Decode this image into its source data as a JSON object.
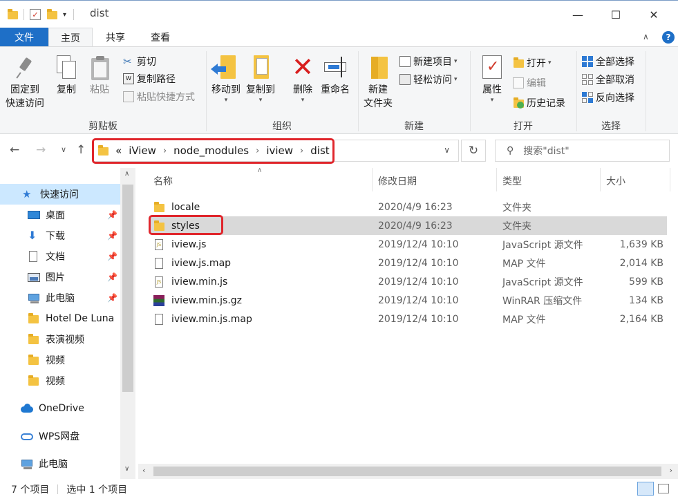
{
  "window": {
    "title": "dist",
    "controls": {
      "minimize": "—",
      "maximize": "☐",
      "close": "✕"
    }
  },
  "ribbon_tabs": [
    "文件",
    "主页",
    "共享",
    "查看"
  ],
  "ribbon": {
    "clipboard": {
      "label": "剪贴板",
      "pin_label_1": "固定到",
      "pin_label_2": "快速访问",
      "copy_label": "复制",
      "paste_label": "粘贴",
      "cut_label": "剪切",
      "copy_path_label": "复制路径",
      "paste_shortcut_label": "粘贴快捷方式"
    },
    "organize": {
      "label": "组织",
      "move_to_label": "移动到",
      "copy_to_label": "复制到",
      "delete_label": "删除",
      "rename_label": "重命名"
    },
    "new": {
      "label": "新建",
      "new_folder_label_1": "新建",
      "new_folder_label_2": "文件夹",
      "new_item_label": "新建项目",
      "easy_access_label": "轻松访问"
    },
    "open": {
      "label": "打开",
      "properties_label": "属性",
      "open_label": "打开",
      "edit_label": "编辑",
      "history_label": "历史记录"
    },
    "select": {
      "label": "选择",
      "select_all_label": "全部选择",
      "select_none_label": "全部取消",
      "invert_label": "反向选择"
    }
  },
  "address": {
    "overflow": "«",
    "crumbs": [
      "iView",
      "node_modules",
      "iview",
      "dist"
    ],
    "search_placeholder": "搜索\"dist\""
  },
  "nav": {
    "quick_access": "快速访问",
    "items": [
      "桌面",
      "下载",
      "文档",
      "图片",
      "此电脑",
      "Hotel De Luna",
      "表演视频",
      "视频",
      "视频"
    ],
    "onedrive": "OneDrive",
    "wps": "WPS网盘",
    "this_pc": "此电脑"
  },
  "columns": {
    "name": "名称",
    "date": "修改日期",
    "type": "类型",
    "size": "大小"
  },
  "files": [
    {
      "name": "locale",
      "date": "2020/4/9 16:23",
      "type": "文件夹",
      "size": "",
      "icon": "folder-icon"
    },
    {
      "name": "styles",
      "date": "2020/4/9 16:23",
      "type": "文件夹",
      "size": "",
      "icon": "folder-icon"
    },
    {
      "name": "iview.js",
      "date": "2019/12/4 10:10",
      "type": "JavaScript 源文件",
      "size": "1,639 KB",
      "icon": "js-file-icon"
    },
    {
      "name": "iview.js.map",
      "date": "2019/12/4 10:10",
      "type": "MAP 文件",
      "size": "2,014 KB",
      "icon": "file-icon"
    },
    {
      "name": "iview.min.js",
      "date": "2019/12/4 10:10",
      "type": "JavaScript 源文件",
      "size": "599 KB",
      "icon": "js-file-icon"
    },
    {
      "name": "iview.min.js.gz",
      "date": "2019/12/4 10:10",
      "type": "WinRAR 压缩文件",
      "size": "134 KB",
      "icon": "winrar-icon"
    },
    {
      "name": "iview.min.js.map",
      "date": "2019/12/4 10:10",
      "type": "MAP 文件",
      "size": "2,164 KB",
      "icon": "file-icon"
    }
  ],
  "status": {
    "count": "7 个项目",
    "selected": "选中 1 个项目"
  },
  "colors": {
    "accent": "#1e6fc7",
    "highlight": "#e0262c",
    "selected_row": "#d9d9d9",
    "nav_selected": "#cce8ff"
  }
}
